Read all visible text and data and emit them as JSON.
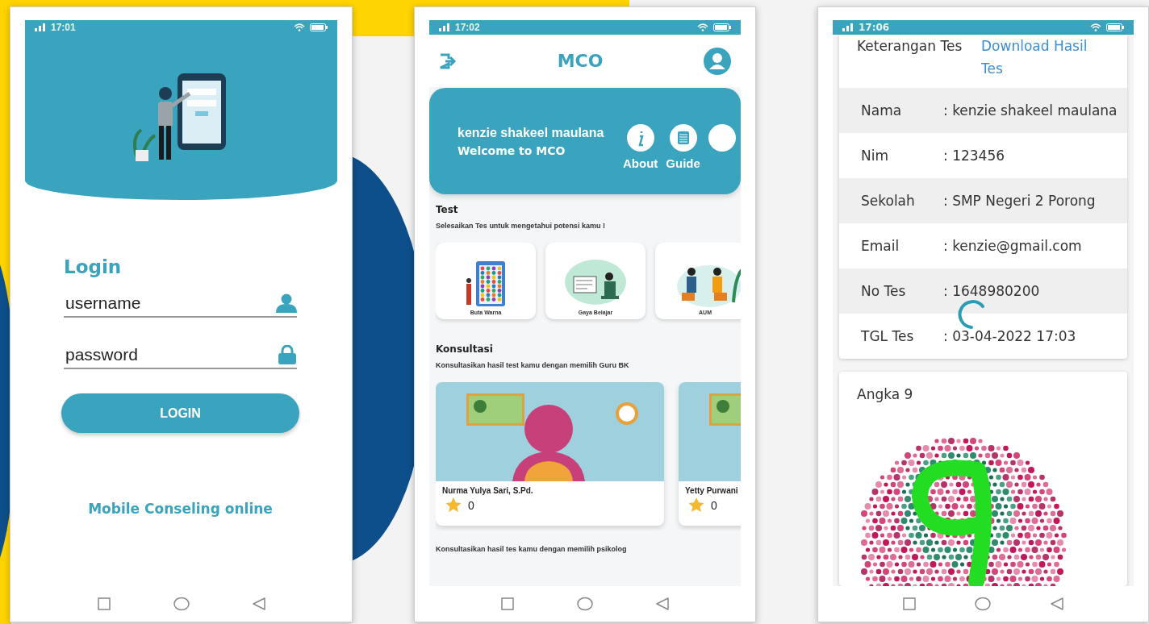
{
  "login_screen": {
    "status_bar": {
      "time": "17:01"
    },
    "title": "Login",
    "username": {
      "placeholder": "username"
    },
    "password": {
      "placeholder": "password"
    },
    "login_button": "LOGIN",
    "footer": "Mobile Conseling online"
  },
  "home_screen": {
    "status_bar": {
      "time": "17:02"
    },
    "app_title": "MCO",
    "banner": {
      "user_name": "kenzie shakeel maulana",
      "greeting": "Welcome to MCO",
      "actions": [
        {
          "kind": "info",
          "label": "About"
        },
        {
          "kind": "guide",
          "label": "Guide"
        },
        {
          "kind": "more"
        }
      ]
    },
    "test_section": {
      "title": "Test",
      "subtitle": "Selesaikan Tes untuk mengetahui potensi kamu !",
      "cards": [
        {
          "kind": "color-chart",
          "label": "Buta Warna"
        },
        {
          "kind": "study",
          "label": "Gaya Belajar"
        },
        {
          "kind": "discussion",
          "label": "AUM"
        }
      ]
    },
    "consult_section": {
      "title": "Konsultasi",
      "subtitle": "Konsultasikan hasil test kamu dengan memilih Guru BK",
      "counselors": [
        {
          "name": "Nurma Yulya Sari, S.Pd.",
          "rating": "0"
        },
        {
          "name": "Yetty Purwani",
          "rating": "0"
        }
      ]
    },
    "psychologist_subtitle": "Konsultasikan hasil tes kamu dengan memilih psikolog"
  },
  "result_screen": {
    "status_bar": {
      "time": "17:06"
    },
    "header": {
      "label": "Keterangan Tes",
      "link": "Download Hasil Tes"
    },
    "rows": [
      {
        "label": "Nama",
        "value": ": kenzie shakeel maulana"
      },
      {
        "label": "Nim",
        "value": ": 123456"
      },
      {
        "label": "Sekolah",
        "value": ": SMP Negeri 2 Porong"
      },
      {
        "label": "Email",
        "value": ": kenzie@gmail.com"
      },
      {
        "label": "No Tes",
        "value": ": 1648980200"
      },
      {
        "label": "TGL Tes",
        "value": ": 03-04-2022 17:03"
      }
    ],
    "loading": true,
    "plate": {
      "caption": "Angka 9"
    }
  }
}
